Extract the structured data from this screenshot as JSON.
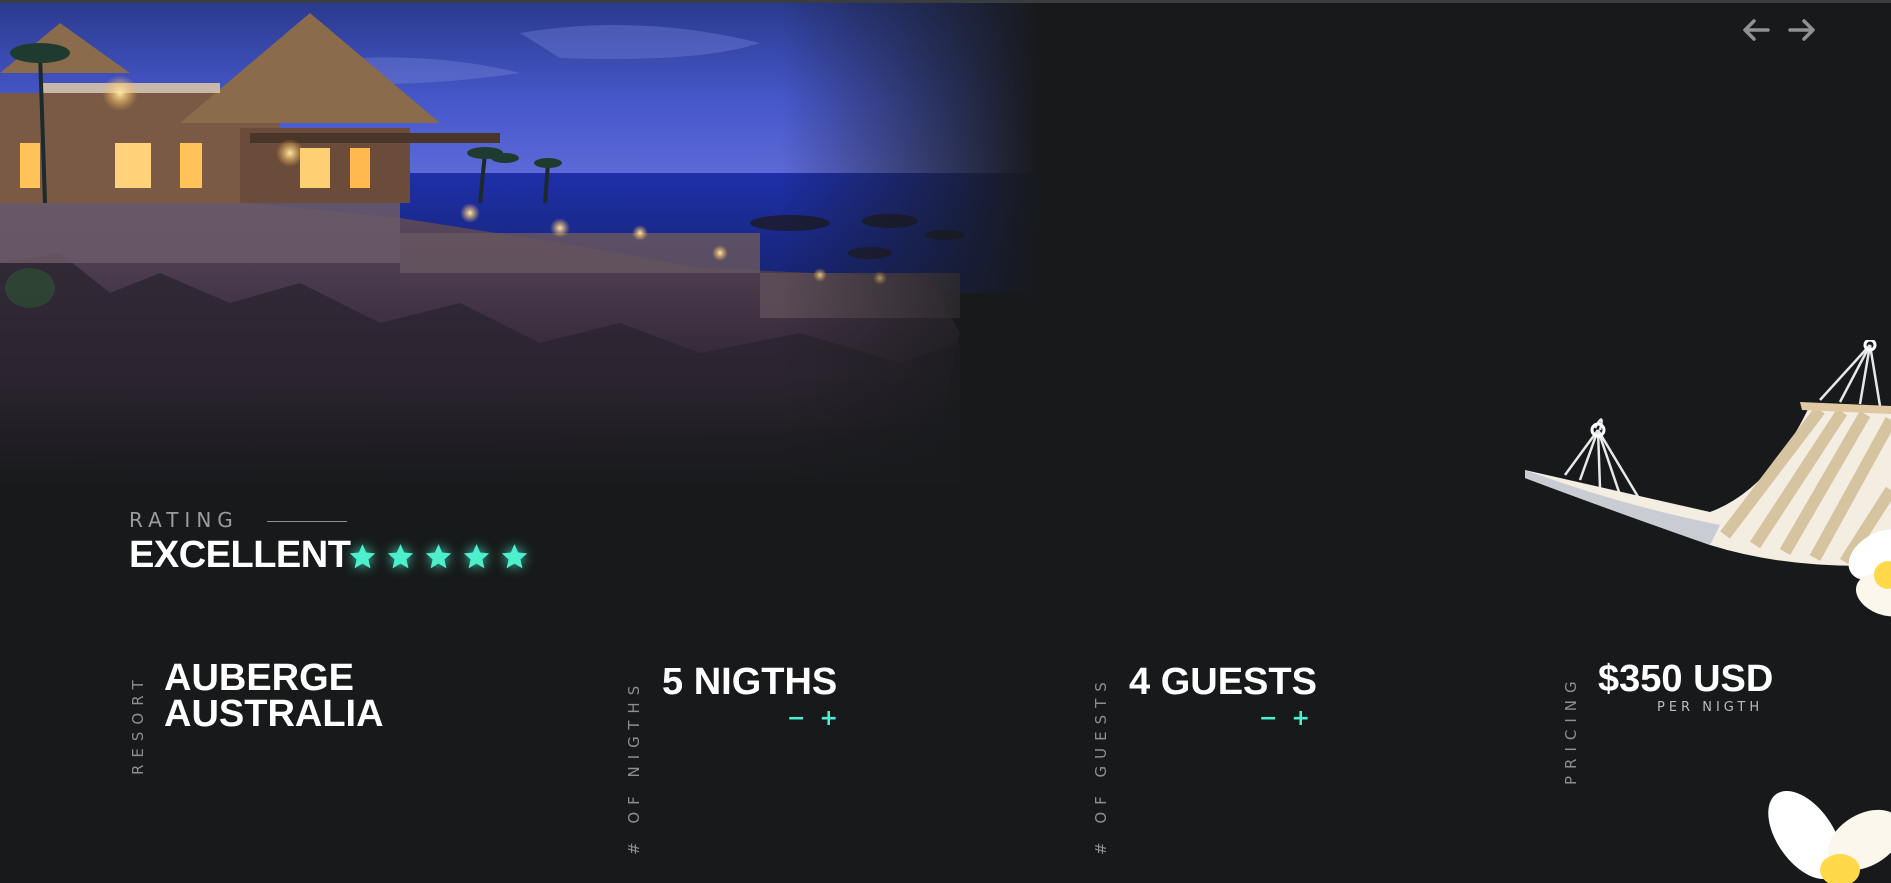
{
  "nav": {
    "prev_icon": "arrow-left-icon",
    "next_icon": "arrow-right-icon"
  },
  "rating": {
    "label": "RATING",
    "value": "EXCELLENT",
    "stars": 5,
    "star_color": "#4df0cd"
  },
  "resort": {
    "label": "RESORT",
    "name_line1": "AUBERGE",
    "name_line2": "AUSTRALIA"
  },
  "nights": {
    "label": "# OF NIGTHS",
    "value": "5 NIGTHS",
    "minus": "−",
    "plus": "+"
  },
  "guests": {
    "label": "# OF GUESTS",
    "value": "4 GUESTS",
    "minus": "−",
    "plus": "+"
  },
  "pricing": {
    "label": "PRICING",
    "value": "$350 USD",
    "sub": "PER NIGTH"
  },
  "colors": {
    "background": "#17191a",
    "accent": "#4df0cd",
    "text": "#ffffff",
    "muted": "#8c8f91"
  }
}
